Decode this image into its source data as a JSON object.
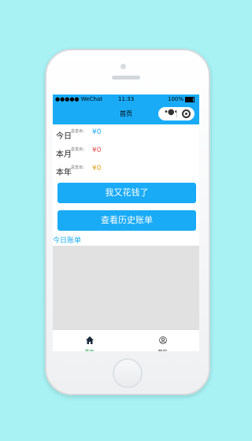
{
  "status_bar": {
    "carrier": "●●●●● WeChat",
    "time": "11:33",
    "battery": "100%"
  },
  "nav": {
    "title": "首页",
    "capsule_menu_icon": "more-dots-icon",
    "capsule_close_icon": "target-icon"
  },
  "summary": [
    {
      "label": "今日",
      "sub": "总支出：",
      "amount": "¥0",
      "color": "#1aabf6"
    },
    {
      "label": "本月",
      "sub": "总支出：",
      "amount": "¥0",
      "color": "#e05050"
    },
    {
      "label": "本年",
      "sub": "总支出：",
      "amount": "¥0",
      "color": "#e0a020"
    }
  ],
  "buttons": {
    "spend": "我又花钱了",
    "history": "查看历史账单"
  },
  "today_link": "今日账单",
  "tabbar": [
    {
      "label": "首页",
      "icon": "home-icon",
      "active": true
    },
    {
      "label": "我的",
      "icon": "user-icon",
      "active": false
    }
  ]
}
